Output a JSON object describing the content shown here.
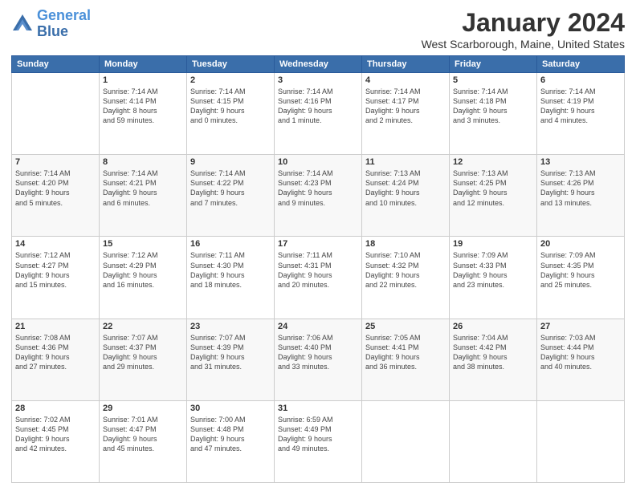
{
  "header": {
    "logo_line1": "General",
    "logo_line2": "Blue",
    "month": "January 2024",
    "location": "West Scarborough, Maine, United States"
  },
  "weekdays": [
    "Sunday",
    "Monday",
    "Tuesday",
    "Wednesday",
    "Thursday",
    "Friday",
    "Saturday"
  ],
  "weeks": [
    [
      {
        "day": "",
        "content": ""
      },
      {
        "day": "1",
        "content": "Sunrise: 7:14 AM\nSunset: 4:14 PM\nDaylight: 8 hours\nand 59 minutes."
      },
      {
        "day": "2",
        "content": "Sunrise: 7:14 AM\nSunset: 4:15 PM\nDaylight: 9 hours\nand 0 minutes."
      },
      {
        "day": "3",
        "content": "Sunrise: 7:14 AM\nSunset: 4:16 PM\nDaylight: 9 hours\nand 1 minute."
      },
      {
        "day": "4",
        "content": "Sunrise: 7:14 AM\nSunset: 4:17 PM\nDaylight: 9 hours\nand 2 minutes."
      },
      {
        "day": "5",
        "content": "Sunrise: 7:14 AM\nSunset: 4:18 PM\nDaylight: 9 hours\nand 3 minutes."
      },
      {
        "day": "6",
        "content": "Sunrise: 7:14 AM\nSunset: 4:19 PM\nDaylight: 9 hours\nand 4 minutes."
      }
    ],
    [
      {
        "day": "7",
        "content": "Sunrise: 7:14 AM\nSunset: 4:20 PM\nDaylight: 9 hours\nand 5 minutes."
      },
      {
        "day": "8",
        "content": "Sunrise: 7:14 AM\nSunset: 4:21 PM\nDaylight: 9 hours\nand 6 minutes."
      },
      {
        "day": "9",
        "content": "Sunrise: 7:14 AM\nSunset: 4:22 PM\nDaylight: 9 hours\nand 7 minutes."
      },
      {
        "day": "10",
        "content": "Sunrise: 7:14 AM\nSunset: 4:23 PM\nDaylight: 9 hours\nand 9 minutes."
      },
      {
        "day": "11",
        "content": "Sunrise: 7:13 AM\nSunset: 4:24 PM\nDaylight: 9 hours\nand 10 minutes."
      },
      {
        "day": "12",
        "content": "Sunrise: 7:13 AM\nSunset: 4:25 PM\nDaylight: 9 hours\nand 12 minutes."
      },
      {
        "day": "13",
        "content": "Sunrise: 7:13 AM\nSunset: 4:26 PM\nDaylight: 9 hours\nand 13 minutes."
      }
    ],
    [
      {
        "day": "14",
        "content": "Sunrise: 7:12 AM\nSunset: 4:27 PM\nDaylight: 9 hours\nand 15 minutes."
      },
      {
        "day": "15",
        "content": "Sunrise: 7:12 AM\nSunset: 4:29 PM\nDaylight: 9 hours\nand 16 minutes."
      },
      {
        "day": "16",
        "content": "Sunrise: 7:11 AM\nSunset: 4:30 PM\nDaylight: 9 hours\nand 18 minutes."
      },
      {
        "day": "17",
        "content": "Sunrise: 7:11 AM\nSunset: 4:31 PM\nDaylight: 9 hours\nand 20 minutes."
      },
      {
        "day": "18",
        "content": "Sunrise: 7:10 AM\nSunset: 4:32 PM\nDaylight: 9 hours\nand 22 minutes."
      },
      {
        "day": "19",
        "content": "Sunrise: 7:09 AM\nSunset: 4:33 PM\nDaylight: 9 hours\nand 23 minutes."
      },
      {
        "day": "20",
        "content": "Sunrise: 7:09 AM\nSunset: 4:35 PM\nDaylight: 9 hours\nand 25 minutes."
      }
    ],
    [
      {
        "day": "21",
        "content": "Sunrise: 7:08 AM\nSunset: 4:36 PM\nDaylight: 9 hours\nand 27 minutes."
      },
      {
        "day": "22",
        "content": "Sunrise: 7:07 AM\nSunset: 4:37 PM\nDaylight: 9 hours\nand 29 minutes."
      },
      {
        "day": "23",
        "content": "Sunrise: 7:07 AM\nSunset: 4:39 PM\nDaylight: 9 hours\nand 31 minutes."
      },
      {
        "day": "24",
        "content": "Sunrise: 7:06 AM\nSunset: 4:40 PM\nDaylight: 9 hours\nand 33 minutes."
      },
      {
        "day": "25",
        "content": "Sunrise: 7:05 AM\nSunset: 4:41 PM\nDaylight: 9 hours\nand 36 minutes."
      },
      {
        "day": "26",
        "content": "Sunrise: 7:04 AM\nSunset: 4:42 PM\nDaylight: 9 hours\nand 38 minutes."
      },
      {
        "day": "27",
        "content": "Sunrise: 7:03 AM\nSunset: 4:44 PM\nDaylight: 9 hours\nand 40 minutes."
      }
    ],
    [
      {
        "day": "28",
        "content": "Sunrise: 7:02 AM\nSunset: 4:45 PM\nDaylight: 9 hours\nand 42 minutes."
      },
      {
        "day": "29",
        "content": "Sunrise: 7:01 AM\nSunset: 4:47 PM\nDaylight: 9 hours\nand 45 minutes."
      },
      {
        "day": "30",
        "content": "Sunrise: 7:00 AM\nSunset: 4:48 PM\nDaylight: 9 hours\nand 47 minutes."
      },
      {
        "day": "31",
        "content": "Sunrise: 6:59 AM\nSunset: 4:49 PM\nDaylight: 9 hours\nand 49 minutes."
      },
      {
        "day": "",
        "content": ""
      },
      {
        "day": "",
        "content": ""
      },
      {
        "day": "",
        "content": ""
      }
    ]
  ]
}
